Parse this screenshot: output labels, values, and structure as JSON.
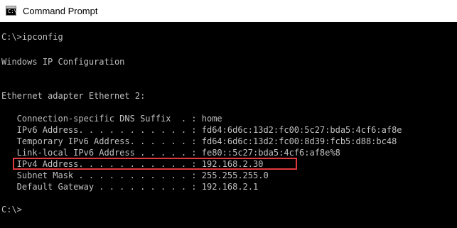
{
  "window": {
    "title": "Command Prompt",
    "icon": "cmd-icon",
    "icon_glyph": "C:\\"
  },
  "console": {
    "lines": [
      "C:\\>ipconfig",
      "",
      "Windows IP Configuration",
      "",
      "",
      "Ethernet adapter Ethernet 2:",
      "",
      "   Connection-specific DNS Suffix  . : home",
      "   IPv6 Address. . . . . . . . . . . : fd64:6d6c:13d2:fc00:5c27:bda5:4cf6:af8e",
      "   Temporary IPv6 Address. . . . . . : fd64:6d6c:13d2:fc00:8d39:fcb5:d88:bc48",
      "   Link-local IPv6 Address . . . . . : fe80::5c27:bda5:4cf6:af8e%8",
      "   IPv4 Address. . . . . . . . . . . : 192.168.2.30",
      "   Subnet Mask . . . . . . . . . . . : 255.255.255.0",
      "   Default Gateway . . . . . . . . . : 192.168.2.1",
      "",
      "C:\\>"
    ],
    "highlighted_line_index": 11
  },
  "colors": {
    "console_background": "#000000",
    "console_text": "#c0c0c0",
    "highlight_border": "#e0393e",
    "titlebar_background": "#ffffff"
  }
}
